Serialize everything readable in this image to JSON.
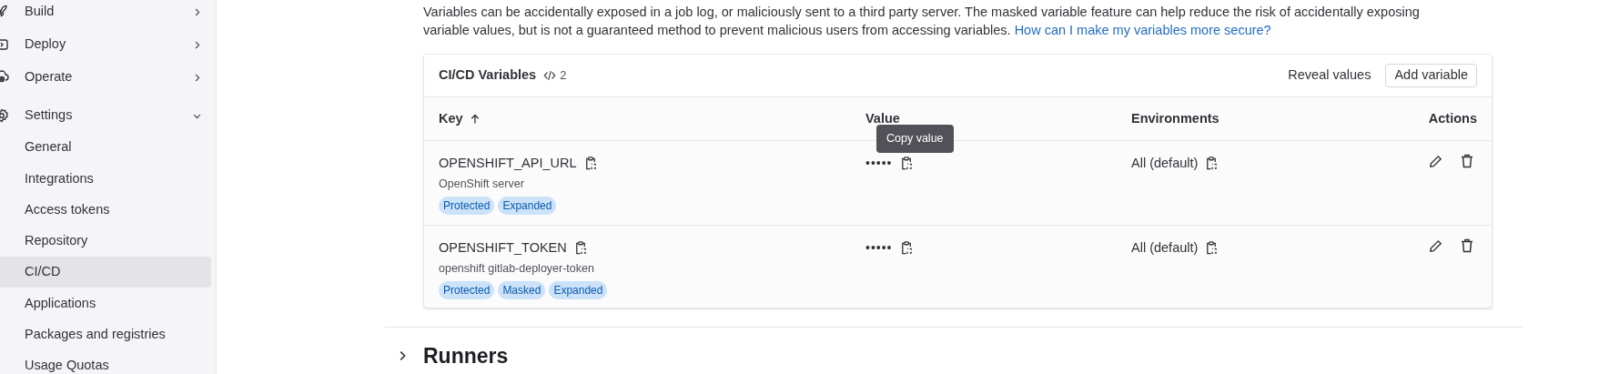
{
  "sidebar": {
    "items": [
      {
        "label": "Build",
        "expanded": false,
        "selected": false
      },
      {
        "label": "Deploy",
        "expanded": false,
        "selected": false
      },
      {
        "label": "Operate",
        "expanded": false,
        "selected": false
      },
      {
        "label": "Settings",
        "expanded": true,
        "selected": false,
        "children": [
          {
            "label": "General",
            "selected": false
          },
          {
            "label": "Integrations",
            "selected": false
          },
          {
            "label": "Access tokens",
            "selected": false
          },
          {
            "label": "Repository",
            "selected": false
          },
          {
            "label": "CI/CD",
            "selected": true
          },
          {
            "label": "Applications",
            "selected": false
          },
          {
            "label": "Packages and registries",
            "selected": false
          },
          {
            "label": "Usage Quotas",
            "selected": false
          }
        ]
      }
    ]
  },
  "intro": {
    "text": "Variables can be accidentally exposed in a job log, or maliciously sent to a third party server. The masked variable feature can help reduce the risk of accidentally exposing variable values, but is not a guaranteed method to prevent malicious users from accessing variables.",
    "link": "How can I make my variables more secure?"
  },
  "variables_card": {
    "title": "CI/CD Variables",
    "count": "2",
    "reveal_button": "Reveal values",
    "add_button": "Add variable",
    "columns": [
      "Key",
      "Value",
      "Environments",
      "Actions"
    ],
    "rows": [
      {
        "key": "OPENSHIFT_API_URL",
        "description": "OpenShift server",
        "badges": [
          "Protected",
          "Expanded"
        ],
        "value": "•••••",
        "environment": "All (default)"
      },
      {
        "key": "OPENSHIFT_TOKEN",
        "description": "openshift gitlab-deployer-token",
        "badges": [
          "Protected",
          "Masked",
          "Expanded"
        ],
        "value": "•••••",
        "environment": "All (default)"
      }
    ],
    "tooltip": "Copy value"
  },
  "runners_section": {
    "title": "Runners",
    "expanded": false
  }
}
